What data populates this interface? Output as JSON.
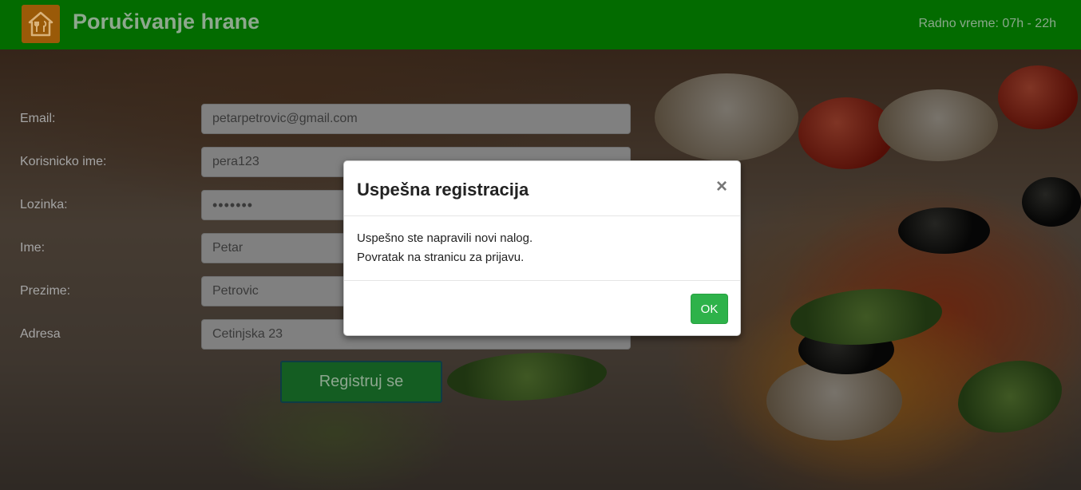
{
  "header": {
    "brand": "Poručivanje hrane",
    "hours": "Radno vreme: 07h - 22h"
  },
  "form": {
    "fields": [
      {
        "label": "Email:",
        "value": "petarpetrovic@gmail.com"
      },
      {
        "label": "Korisnicko ime:",
        "value": "pera123"
      },
      {
        "label": "Lozinka:",
        "value": "•••••••"
      },
      {
        "label": "Ime:",
        "value": "Petar"
      },
      {
        "label": "Prezime:",
        "value": "Petrovic"
      },
      {
        "label": "Adresa",
        "value": "Cetinjska 23"
      }
    ],
    "submit_label": "Registruj se"
  },
  "modal": {
    "title": "Uspešna registracija",
    "close": "×",
    "body_line1": "Uspešno ste napravili novi nalog.",
    "body_line2": "Povratak na stranicu za prijavu.",
    "ok_label": "OK"
  },
  "colors": {
    "header_bg": "#036b00",
    "logo_bg": "#9a5a08",
    "ok_button": "#2eb24a",
    "register_button": "#145d22"
  }
}
